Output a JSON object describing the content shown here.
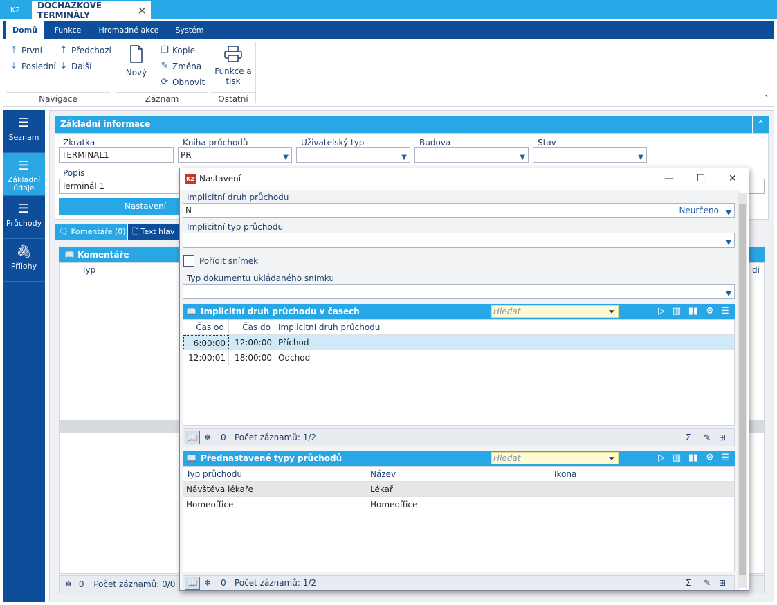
{
  "titlebar": {
    "app_label": "K2",
    "doc_tab": "DOCHÁZKOVÉ TERMINÁLY",
    "close": "✕"
  },
  "ribbon": {
    "tabs": [
      "Domů",
      "Funkce",
      "Hromadné akce",
      "Systém"
    ],
    "nav": {
      "first": "První",
      "prev": "Předchozí",
      "last": "Poslední",
      "next": "Další",
      "group": "Navigace"
    },
    "record": {
      "new": "Nový",
      "copy": "Kopie",
      "change": "Změna",
      "refresh": "Obnovit",
      "group": "Záznam"
    },
    "other": {
      "print_l1": "Funkce a",
      "print_l2": "tisk",
      "group": "Ostatní"
    }
  },
  "sidebar": [
    {
      "label": "Seznam",
      "icon": "list-icon"
    },
    {
      "label_l1": "Základní",
      "label_l2": "údaje",
      "icon": "list-icon"
    },
    {
      "label": "Průchody",
      "icon": "list-icon"
    },
    {
      "label": "Přílohy",
      "icon": "paperclip-icon"
    }
  ],
  "basic": {
    "title": "Základní informace",
    "zkratka_label": "Zkratka",
    "zkratka_value": "TERMINAL1",
    "kniha_label": "Kniha průchodů",
    "kniha_value": "PR",
    "uzivtyp_label": "Uživatelský typ",
    "budova_label": "Budova",
    "stav_label": "Stav",
    "popis_label": "Popis",
    "popis_value": "Terminál 1",
    "settings_button": "Nastavení"
  },
  "comments": {
    "tab1": "Komentáře (0)",
    "tab2": "Text hlav",
    "title": "Komentáře",
    "col_typ": "Typ",
    "col_partial": "di",
    "count": "0",
    "records": "Počet záznamů: 0/0"
  },
  "dialog": {
    "title": "Nastavení",
    "f1_label": "Implicitní druh průchodu",
    "f1_value": "N",
    "f1_right": "Neurčeno",
    "f2_label": "Implicitní typ průchodu",
    "checkbox_label": "Pořídit snímek",
    "f3_label": "Typ dokumentu ukládaného snímku",
    "grid1": {
      "title": "Implicitní druh průchodu v časech",
      "search": "Hledat",
      "cols": [
        "Čas od",
        "Čas do",
        "Implicitní druh průchodu"
      ],
      "rows": [
        [
          "6:00:00",
          "12:00:00",
          "Příchod"
        ],
        [
          "12:00:01",
          "18:00:00",
          "Odchod"
        ]
      ],
      "count": "0",
      "records": "Počet záznamů: 1/2"
    },
    "grid2": {
      "title": "Přednastavené typy průchodů",
      "search": "Hledat",
      "cols": [
        "Typ průchodu",
        "Název",
        "Ikona"
      ],
      "rows": [
        [
          "Návštěva lékaře",
          "Lékař",
          ""
        ],
        [
          "Homeoffice",
          "Homeoffice",
          ""
        ]
      ],
      "count": "0",
      "records": "Počet záznamů: 1/2"
    }
  },
  "colors": {
    "accent": "#28a7e6",
    "navy": "#0e4d9a"
  }
}
